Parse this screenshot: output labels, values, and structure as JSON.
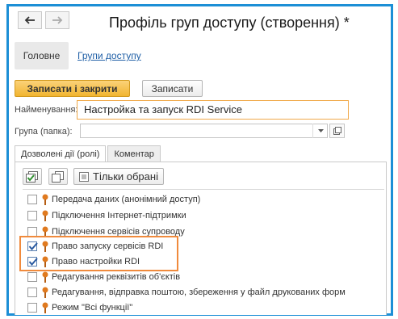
{
  "window": {
    "title": "Профіль груп доступу (створення) *"
  },
  "navigation": {
    "back_icon": "arrow-left-icon",
    "forward_icon": "arrow-right-icon"
  },
  "sections": {
    "main": "Головне",
    "link": "Групи доступу"
  },
  "toolbar": {
    "save_close_label": "Записати і закрити",
    "save_label": "Записати"
  },
  "form": {
    "name_label": "Найменування:",
    "name_value": "Настройка та запуск RDI Service",
    "group_label": "Група (папка):",
    "group_value": ""
  },
  "tabs": [
    {
      "label": "Дозволені дії (ролі)",
      "active": true
    },
    {
      "label": "Коментар",
      "active": false
    }
  ],
  "roles_toolbar": {
    "check_all_icon": "check-all-icon",
    "copy_icon": "copy-icon",
    "only_selected_label": "Тільки обрані"
  },
  "roles": [
    {
      "label": "Передача даних (анонімний доступ)",
      "checked": false
    },
    {
      "label": "Підключення Інтернет-підтримки",
      "checked": false
    },
    {
      "label": "Підключення сервісів супроводу",
      "checked": false
    },
    {
      "label": "Право запуску сервісів RDI",
      "checked": true
    },
    {
      "label": "Право настройки RDI",
      "checked": true
    },
    {
      "label": "Редагування реквізитів об'єктів",
      "checked": false
    },
    {
      "label": "Редагування, відправка поштою, збереження у файл друкованих форм",
      "checked": false
    },
    {
      "label": "Режим \"Всі функції\"",
      "checked": false
    }
  ],
  "colors": {
    "frame": "#1c8fd6",
    "highlight": "#f08a3c",
    "primary_button": "#f1b530",
    "role_pin": "#e07a1f"
  }
}
